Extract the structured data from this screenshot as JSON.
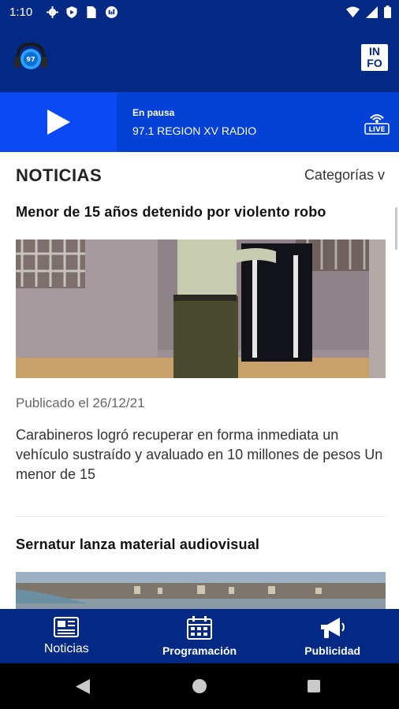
{
  "status_bar": {
    "time": "1:10"
  },
  "header": {
    "info_line1": "IN",
    "info_line2": "FO"
  },
  "player": {
    "status": "En pausa",
    "station": "97.1 REGION XV RADIO",
    "live_label": "LIVE"
  },
  "news": {
    "section_title": "NOTICIAS",
    "categories_label": "Categorías v",
    "articles": [
      {
        "title": "Menor de 15 años detenido por violento robo",
        "date": "Publicado el 26/12/21",
        "description": "Carabineros logró recuperar en forma inmediata un vehículo sustraído y avaluado en 10 millones de pesos Un menor de 15"
      },
      {
        "title": "Sernatur lanza material audiovisual"
      }
    ]
  },
  "bottom_nav": [
    {
      "label": "Noticias"
    },
    {
      "label": "Programación"
    },
    {
      "label": "Publicidad"
    }
  ],
  "colors": {
    "primary": "#022a84",
    "accent": "#0e4ff0"
  },
  "icons": [
    "settings-icon",
    "shield-icon",
    "sim-icon",
    "chart-icon",
    "wifi-icon",
    "signal-icon",
    "battery-icon",
    "radio-logo-icon",
    "play-icon",
    "live-radio-icon",
    "newspaper-icon",
    "calendar-icon",
    "megaphone-icon",
    "back-icon",
    "home-icon",
    "recent-apps-icon"
  ]
}
